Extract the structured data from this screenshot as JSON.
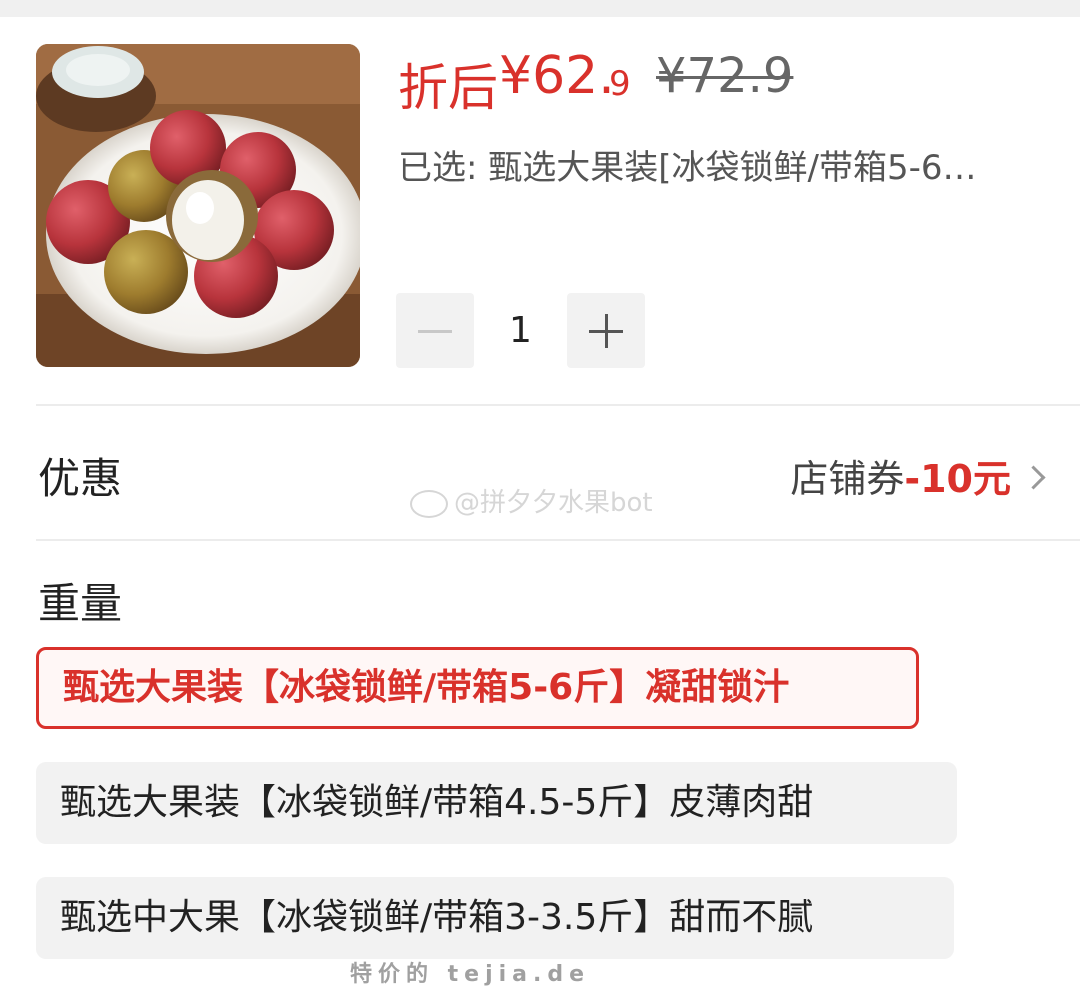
{
  "product": {
    "image_label": "lychee-product-photo",
    "price_prefix": "折后",
    "price_main": "¥62.",
    "price_decimal": "9",
    "original_price": "¥72.9",
    "selected_text": "已选: 甄选大果装[冰袋锁鲜/带箱5-6…"
  },
  "stepper": {
    "quantity": "1"
  },
  "promotion": {
    "label": "优惠",
    "coupon_text": "店铺券",
    "coupon_value": "-10元"
  },
  "watermark": {
    "text": "@拼夕夕水果bot"
  },
  "weight": {
    "label": "重量",
    "options": [
      {
        "label": "甄选大果装【冰袋锁鲜/带箱5-6斤】凝甜锁汁",
        "selected": true
      },
      {
        "label": "甄选大果装【冰袋锁鲜/带箱4.5-5斤】皮薄肉甜",
        "selected": false
      },
      {
        "label": "甄选中大果【冰袋锁鲜/带箱3-3.5斤】甜而不腻",
        "selected": false
      }
    ]
  },
  "footer": {
    "site_mark": "特价的 tejia.de"
  },
  "colors": {
    "accent": "#d9312b",
    "option_bg": "#f2f2f2",
    "divider": "#ececec"
  }
}
